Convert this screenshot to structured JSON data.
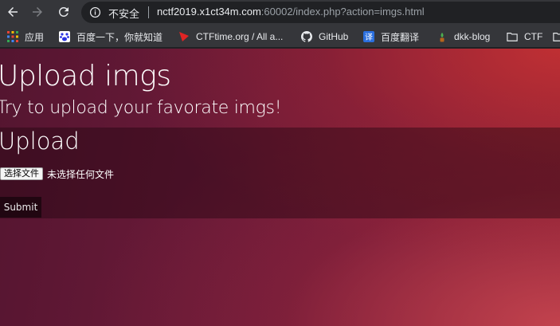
{
  "browser": {
    "security_label": "不安全",
    "url_host": "nctf2019.x1ct34m.com",
    "url_rest": ":60002/index.php?action=imgs.html"
  },
  "bookmarks": [
    {
      "label": "应用",
      "icon": "apps-grid-icon"
    },
    {
      "label": "百度一下，你就知道",
      "icon": "baidu-paw-icon"
    },
    {
      "label": "CTFtime.org / All a...",
      "icon": "ctftime-flag-icon"
    },
    {
      "label": "GitHub",
      "icon": "github-icon"
    },
    {
      "label": "百度翻译",
      "icon": "baidu-translate-icon"
    },
    {
      "label": "dkk-blog",
      "icon": "plant-icon"
    },
    {
      "label": "CTF",
      "icon": "folder-icon"
    }
  ],
  "page": {
    "title": "Upload imgs",
    "subtitle": "Try to upload your favorate imgs!",
    "upload_heading": "Upload",
    "choose_file_label": "选择文件",
    "no_file_label": "未选择任何文件",
    "submit_label": "Submit"
  },
  "colors": {
    "page_bg_dark": "#541530",
    "page_bg_accent": "#c83232",
    "toolbar_bg": "#35363a",
    "omnibox_bg": "#202124"
  }
}
